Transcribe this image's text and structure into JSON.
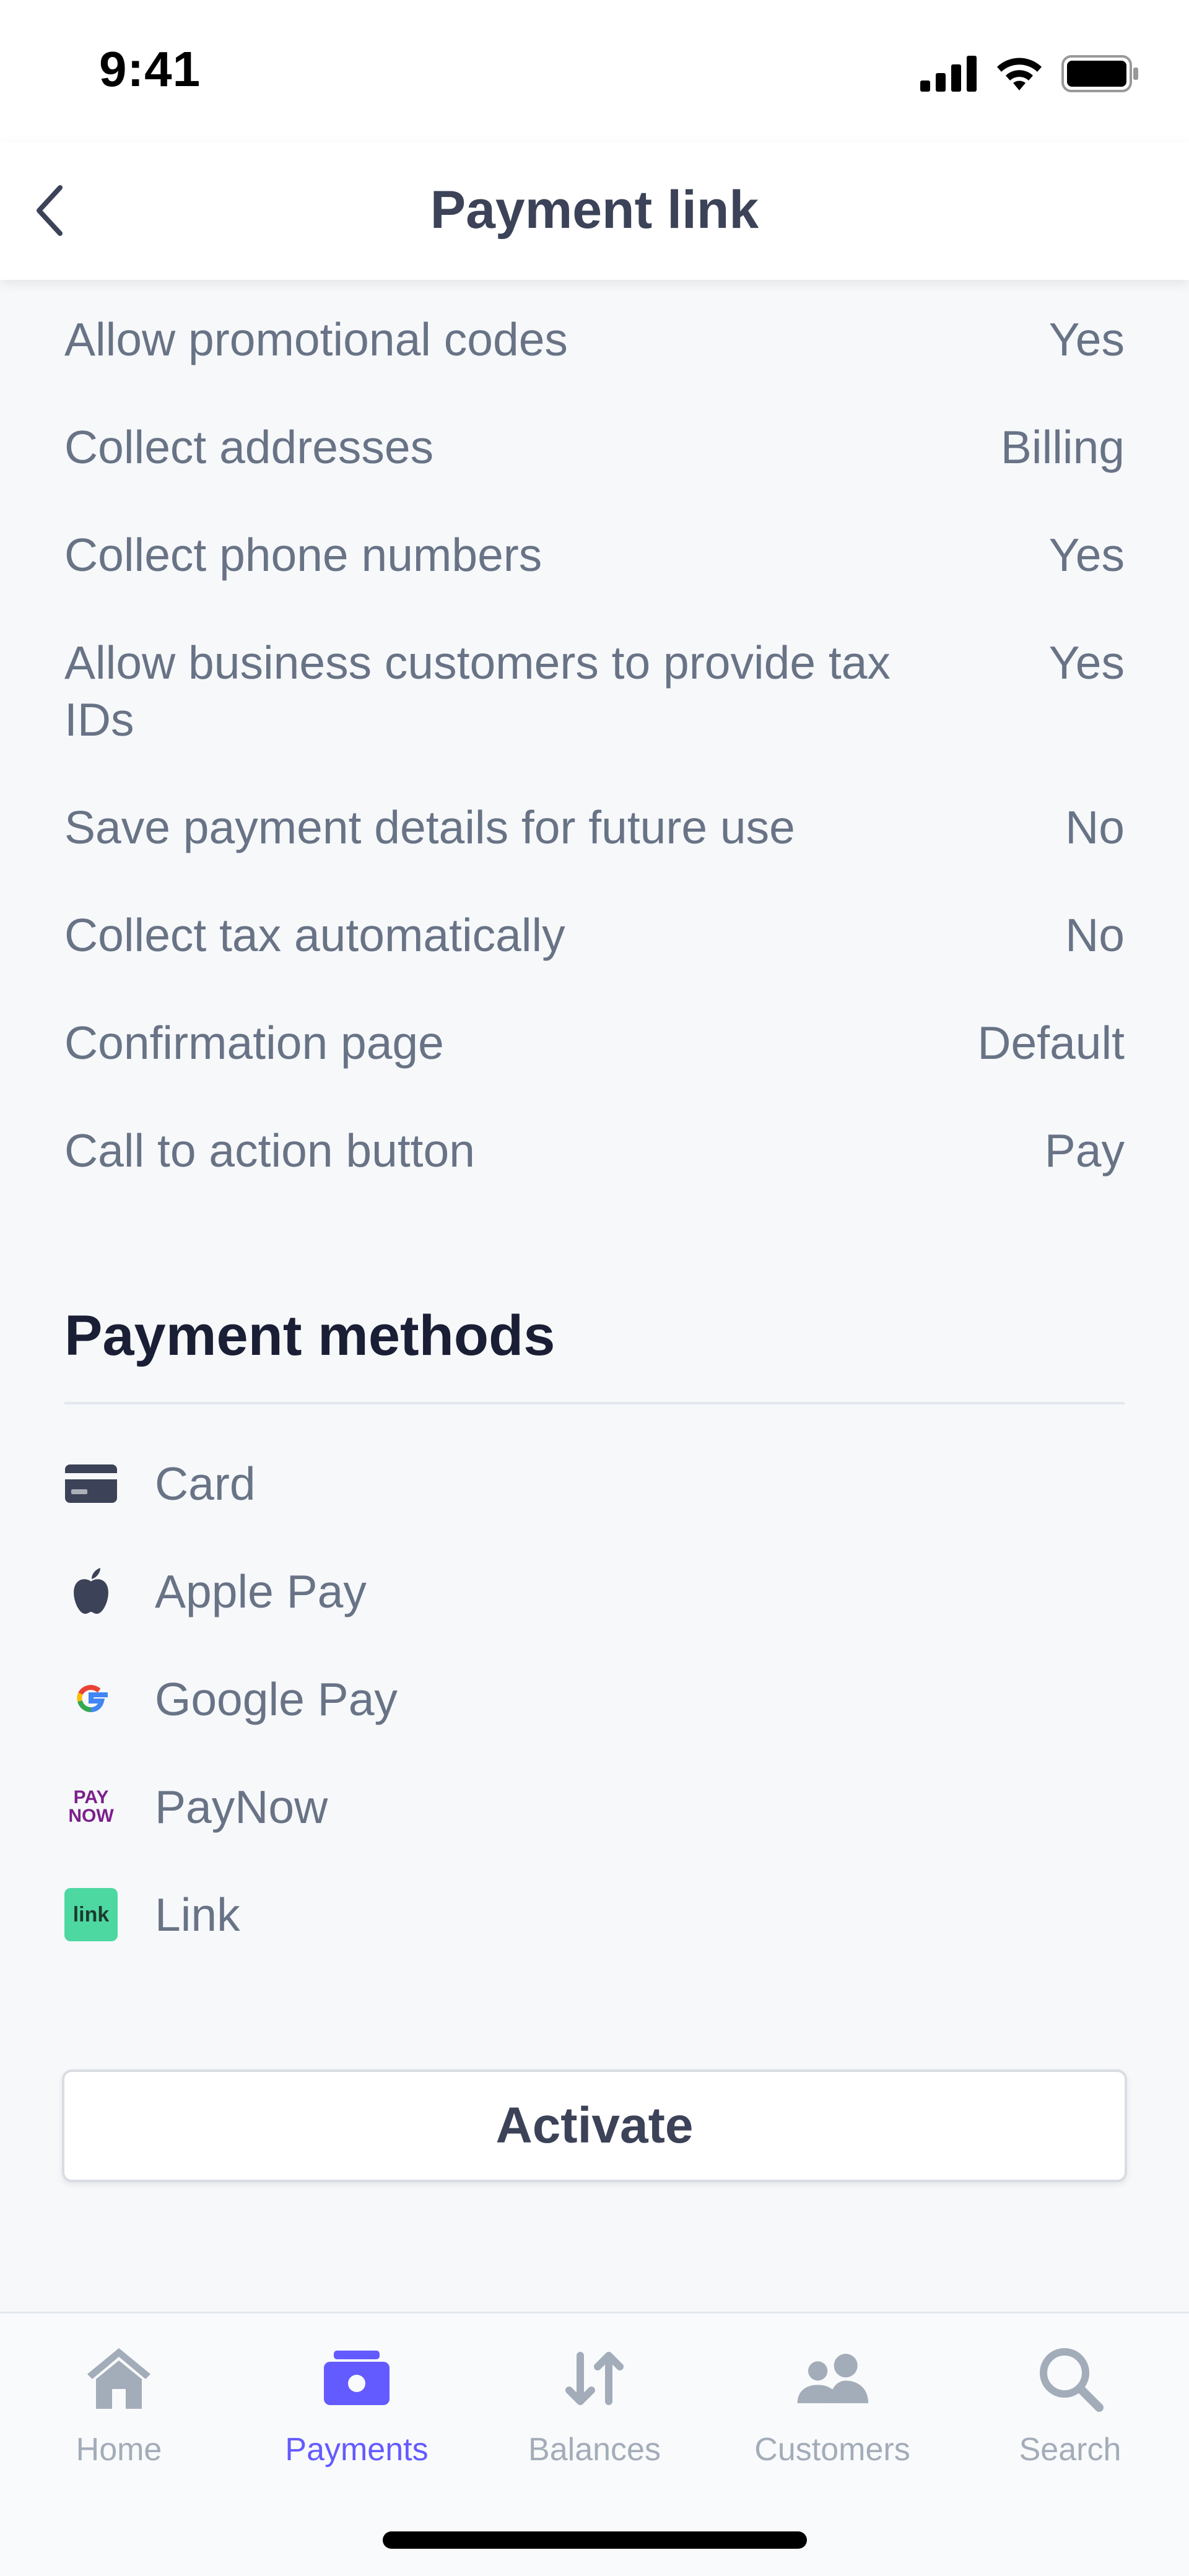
{
  "status_bar": {
    "time": "9:41"
  },
  "header": {
    "title": "Payment link"
  },
  "settings": [
    {
      "label": "Allow promotional codes",
      "value": "Yes"
    },
    {
      "label": "Collect addresses",
      "value": "Billing"
    },
    {
      "label": "Collect phone numbers",
      "value": "Yes"
    },
    {
      "label": "Allow business customers to provide tax IDs",
      "value": "Yes"
    },
    {
      "label": "Save payment details for future use",
      "value": "No"
    },
    {
      "label": "Collect tax automatically",
      "value": "No"
    },
    {
      "label": "Confirmation page",
      "value": "Default"
    },
    {
      "label": "Call to action button",
      "value": "Pay"
    }
  ],
  "payment_methods": {
    "heading": "Payment methods",
    "items": [
      {
        "label": "Card",
        "icon": "card-icon"
      },
      {
        "label": "Apple Pay",
        "icon": "apple-icon"
      },
      {
        "label": "Google Pay",
        "icon": "google-icon"
      },
      {
        "label": "PayNow",
        "icon": "paynow-icon",
        "icon_text": [
          "PAY",
          "NOW"
        ]
      },
      {
        "label": "Link",
        "icon": "link-icon",
        "icon_text": "link"
      }
    ]
  },
  "activate_label": "Activate",
  "tabs": [
    {
      "label": "Home",
      "icon": "home-icon",
      "active": false
    },
    {
      "label": "Payments",
      "icon": "payments-icon",
      "active": true
    },
    {
      "label": "Balances",
      "icon": "balances-icon",
      "active": false
    },
    {
      "label": "Customers",
      "icon": "customers-icon",
      "active": false
    },
    {
      "label": "Search",
      "icon": "search-icon",
      "active": false
    }
  ],
  "colors": {
    "accent": "#635bff",
    "muted": "#a3acb9",
    "text": "#697386"
  }
}
